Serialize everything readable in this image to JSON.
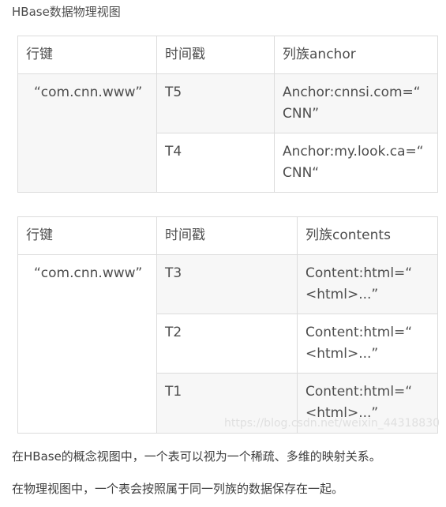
{
  "heading": "HBase数据物理视图",
  "table1": {
    "headers": [
      "行键",
      "时间戳",
      "列族anchor"
    ],
    "rowkey": "“com.cnn.www”",
    "rows": [
      {
        "timestamp": "T5",
        "line1": "Anchor:cnnsi.com=“",
        "line2": "CNN”"
      },
      {
        "timestamp": "T4",
        "line1": "Anchor:my.look.ca=“",
        "line2": "CNN“"
      }
    ]
  },
  "table2": {
    "headers": [
      "行键",
      "时间戳",
      "列族contents"
    ],
    "rowkey": "“com.cnn.www”",
    "rows": [
      {
        "timestamp": "T3",
        "line1": "Content:html=“",
        "line2": "<html>...”"
      },
      {
        "timestamp": "T2",
        "line1": "Content:html=“",
        "line2": "<html>...”"
      },
      {
        "timestamp": "T1",
        "line1": "Content:html=“",
        "line2": "<html>...”"
      }
    ]
  },
  "watermark": "https://blog.csdn.net/weixin_44318830",
  "paragraphs": [
    "在HBase的概念视图中，一个表可以视为一个稀疏、多维的映射关系。",
    "在物理视图中，一个表会按照属于同一列族的数据保存在一起。"
  ],
  "colors": {
    "border": "#dcdcdc",
    "shade": "#f7f7f7",
    "text": "#4d4d4d",
    "icon": "#3b7ddd"
  },
  "icons": {
    "table_action": "scan-icon"
  }
}
